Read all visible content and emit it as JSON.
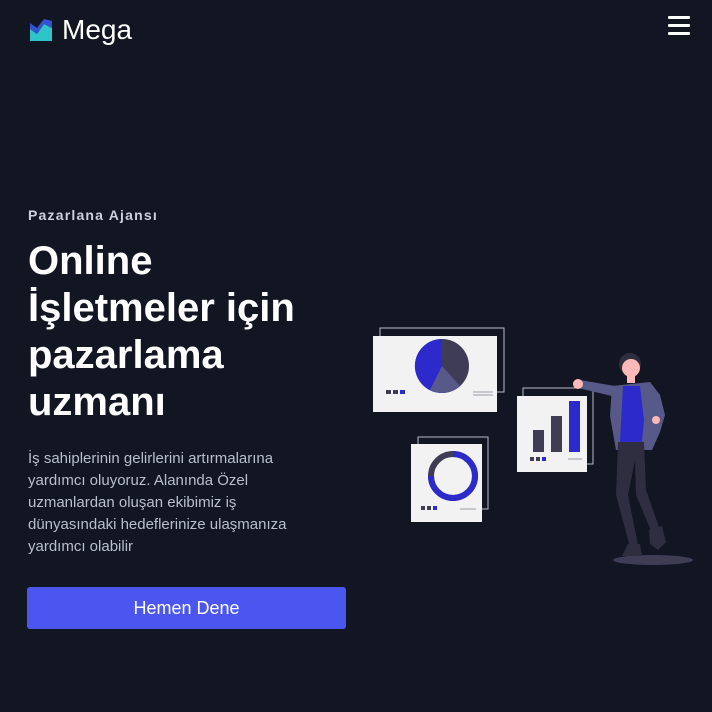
{
  "nav": {
    "brand": "Mega",
    "logo_icon": "chart-logo-icon",
    "menu_icon": "hamburger-menu-icon"
  },
  "hero": {
    "eyebrow": "Pazarlana Ajansı",
    "headline": [
      "Online",
      "İşletmeler için",
      "pazarlama",
      "uzmanı"
    ],
    "description": "İş sahiplerinin gelirlerini artırmalarına yardımcı oluyoruz. Alanında Özel uzmanlardan oluşan ekibimiz iş dünyasındaki hedeflerinize ulaşmanıza yardımcı olabilir",
    "cta_label": "Hemen Dene"
  },
  "colors": {
    "background": "#111622",
    "accent": "#4b56f0",
    "logo_teal": "#2ec4c9",
    "illustration_indigo": "#2d2acb",
    "illustration_slate": "#3f3d56"
  }
}
